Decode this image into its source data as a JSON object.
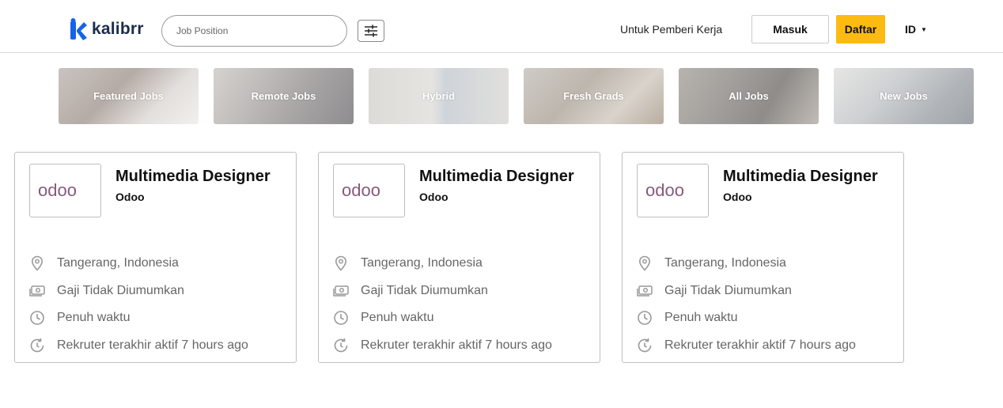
{
  "header": {
    "logo_text": "kalibrr",
    "search_placeholder": "Job Position",
    "employer_link": "Untuk Pemberi Kerja",
    "login_label": "Masuk",
    "register_label": "Daftar",
    "language": "ID",
    "brand_color": "#1663e9",
    "register_color": "#fdbb12"
  },
  "categories": [
    {
      "label": "Featured Jobs"
    },
    {
      "label": "Remote Jobs"
    },
    {
      "label": "Hybrid"
    },
    {
      "label": "Fresh Grads"
    },
    {
      "label": "All Jobs"
    },
    {
      "label": "New Jobs"
    }
  ],
  "jobs": [
    {
      "title": "Multimedia Designer",
      "company": "Odoo",
      "company_logo_text": "odoo",
      "location": "Tangerang, Indonesia",
      "salary": "Gaji Tidak Diumumkan",
      "type": "Penuh waktu",
      "activity": "Rekruter terakhir aktif 7 hours ago"
    },
    {
      "title": "Multimedia Designer",
      "company": "Odoo",
      "company_logo_text": "odoo",
      "location": "Tangerang, Indonesia",
      "salary": "Gaji Tidak Diumumkan",
      "type": "Penuh waktu",
      "activity": "Rekruter terakhir aktif 7 hours ago"
    },
    {
      "title": "Multimedia Designer",
      "company": "Odoo",
      "company_logo_text": "odoo",
      "location": "Tangerang, Indonesia",
      "salary": "Gaji Tidak Diumumkan",
      "type": "Penuh waktu",
      "activity": "Rekruter terakhir aktif 7 hours ago"
    }
  ],
  "icons": {
    "location": "map-pin-icon",
    "salary": "money-icon",
    "type": "clock-icon",
    "activity": "history-icon",
    "filter": "sliders-icon",
    "caret": "caret-down-icon"
  }
}
